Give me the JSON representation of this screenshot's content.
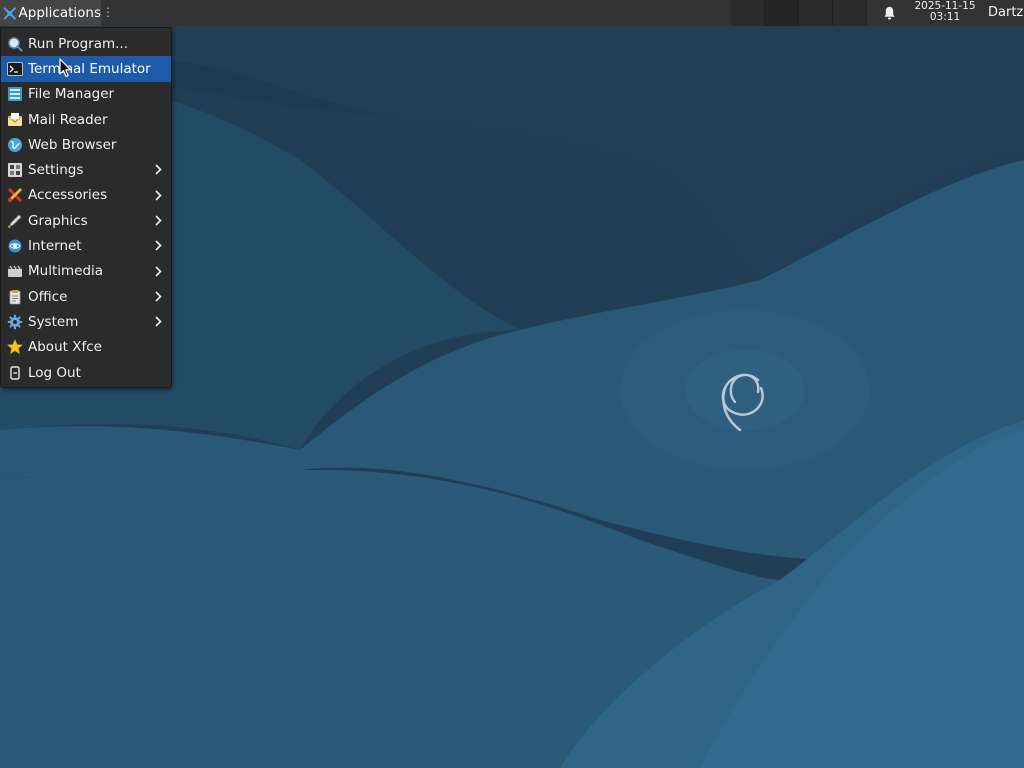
{
  "panel": {
    "applications_label": "Applications",
    "handle_glyph": "⋮",
    "clock_date": "2025-11-15",
    "clock_time": "03:11",
    "user": "Dartz",
    "icons": {
      "applications": "xfce-mouse-icon",
      "notifications": "bell-icon"
    }
  },
  "menu": {
    "items": [
      {
        "label": "Run Program...",
        "icon": "run-program-icon",
        "submenu": false
      },
      {
        "label": "Terminal Emulator",
        "icon": "terminal-icon",
        "submenu": false,
        "highlighted": true
      },
      {
        "label": "File Manager",
        "icon": "file-manager-icon",
        "submenu": false
      },
      {
        "label": "Mail Reader",
        "icon": "mail-icon",
        "submenu": false
      },
      {
        "label": "Web Browser",
        "icon": "web-browser-icon",
        "submenu": false
      },
      {
        "label": "Settings",
        "icon": "settings-icon",
        "submenu": true
      },
      {
        "label": "Accessories",
        "icon": "accessories-icon",
        "submenu": true
      },
      {
        "label": "Graphics",
        "icon": "graphics-icon",
        "submenu": true
      },
      {
        "label": "Internet",
        "icon": "internet-icon",
        "submenu": true
      },
      {
        "label": "Multimedia",
        "icon": "multimedia-icon",
        "submenu": true
      },
      {
        "label": "Office",
        "icon": "office-icon",
        "submenu": true
      },
      {
        "label": "System",
        "icon": "system-icon",
        "submenu": true
      },
      {
        "label": "About Xfce",
        "icon": "star-icon",
        "submenu": false
      },
      {
        "label": "Log Out",
        "icon": "log-out-icon",
        "submenu": false
      }
    ]
  },
  "colors": {
    "panel": "#333333",
    "menu_background": "#2b2b2b",
    "highlight": "#1d5aa8",
    "wallpaper": "#234a66"
  }
}
